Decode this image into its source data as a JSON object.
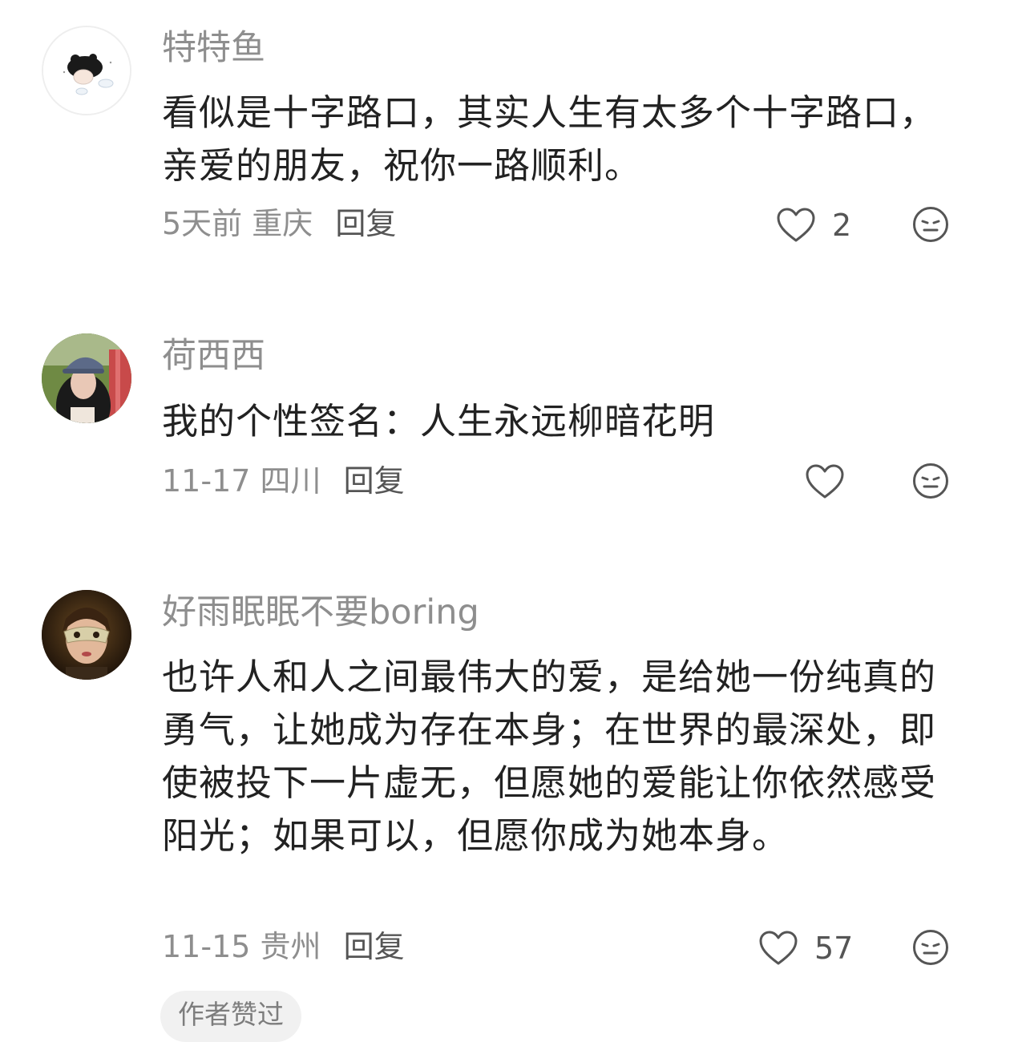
{
  "comments": [
    {
      "username": "特特鱼",
      "text": "看似是十字路口，其实人生有太多个十字路口，亲爱的朋友，祝你一路顺利。",
      "date": "5天前",
      "location": "重庆",
      "reply_label": "回复",
      "likes": "2"
    },
    {
      "username": "荷西西",
      "text": "我的个性签名：人生永远柳暗花明",
      "date": "11-17",
      "location": "四川",
      "reply_label": "回复",
      "likes": ""
    },
    {
      "username": "好雨眠眠不要boring",
      "text": "也许人和人之间最伟大的爱，是给她一份纯真的勇气，让她成为存在本身；在世界的最深处，即使被投下一片虚无，但愿她的爱能让你依然感受阳光；如果可以，但愿你成为她本身。",
      "date": "11-15",
      "location": "贵州",
      "reply_label": "回复",
      "likes": "57",
      "badge": "作者赞过"
    }
  ],
  "icons": {
    "like": "heart-outline-icon",
    "dislike": "neutral-face-icon"
  },
  "colors": {
    "username": "#8e8e8e",
    "text": "#222222",
    "meta": "#8e8e8e",
    "icon": "#555555",
    "badge_bg": "#f1f1f1"
  }
}
